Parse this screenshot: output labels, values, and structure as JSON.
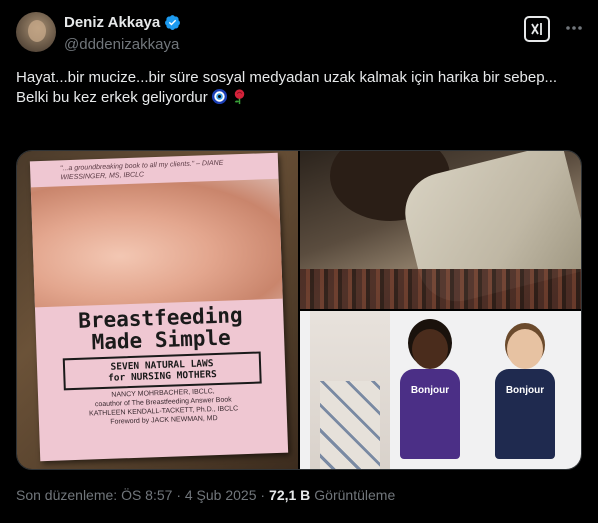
{
  "author": {
    "display_name": "Deniz Akkaya",
    "handle": "@dddenizakkaya",
    "verified": true
  },
  "tweet": {
    "line1": "Hayat...bir mucize...bir süre sosyal medyadan uzak kalmak için harika bir sebep...",
    "line2": "Belki bu kez  erkek geliyordur",
    "emojis": [
      "nazar-icon",
      "rose-icon"
    ]
  },
  "media": {
    "book": {
      "quote": "\"...a groundbreaking book to all my clients.\" – DIANE WIESSINGER, MS, IBCLC",
      "title_line1": "Breastfeeding",
      "title_line2": "Made Simple",
      "subtitle_line1": "SEVEN NATURAL LAWS",
      "subtitle_line2": "for NURSING MOTHERS",
      "author1": "NANCY MOHRBACHER, IBCLC,",
      "author1_note": "coauthor of The Breastfeeding Answer Book",
      "author2": "KATHLEEN KENDALL-TACKETT, Ph.D., IBCLC",
      "foreword": "Foreword by JACK NEWMAN, MD"
    },
    "kids": {
      "shirt1": "Bonjour",
      "shirt2": "Bonjour"
    }
  },
  "footer": {
    "edited": "Son düzenleme: ÖS 8:57 · 4 Şub 2025 ·",
    "views_count": "72,1 B",
    "views_label": "Görüntüleme"
  },
  "colors": {
    "background": "#000000",
    "text": "#e7e9ea",
    "muted": "#71767b",
    "verified": "#1d9bf0"
  }
}
